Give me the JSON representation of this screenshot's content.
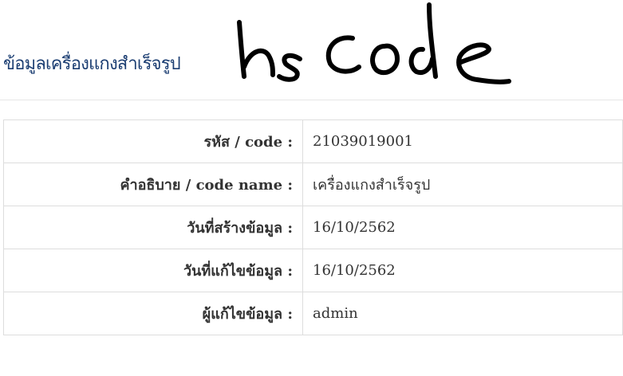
{
  "header": {
    "title": "ข้อมูลเครื่องแกงสำเร็จรูป",
    "handwritten_text": "hs code"
  },
  "details": [
    {
      "label": "รหัส / code :",
      "value": "21039019001"
    },
    {
      "label": "คำอธิบาย / code name :",
      "value": "เครื่องแกงสำเร็จรูป"
    },
    {
      "label": "วันที่สร้างข้อมูล :",
      "value": "16/10/2562"
    },
    {
      "label": "วันที่แก้ไขข้อมูล :",
      "value": "16/10/2562"
    },
    {
      "label": "ผู้แก้ไขข้อมูล :",
      "value": "admin"
    }
  ]
}
